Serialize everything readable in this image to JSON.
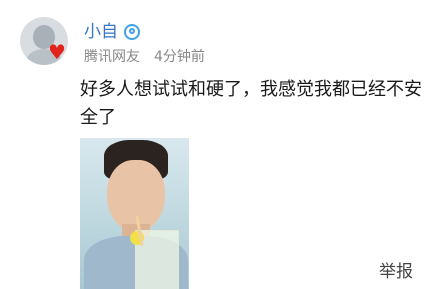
{
  "post": {
    "username": "小自",
    "source": "腾讯网友",
    "time": "4分钟前",
    "content": "好多人想试试和硬了，我感觉我都已经不安全了",
    "report_label": "举报"
  },
  "icons": {
    "avatar": "user-avatar",
    "heart": "heart-icon",
    "verified": "verified-badge-icon",
    "photo": "selfie-photo"
  },
  "colors": {
    "username": "#3576c7",
    "meta": "#888888",
    "heart": "#e1241b",
    "verified": "#3fa2e8"
  }
}
